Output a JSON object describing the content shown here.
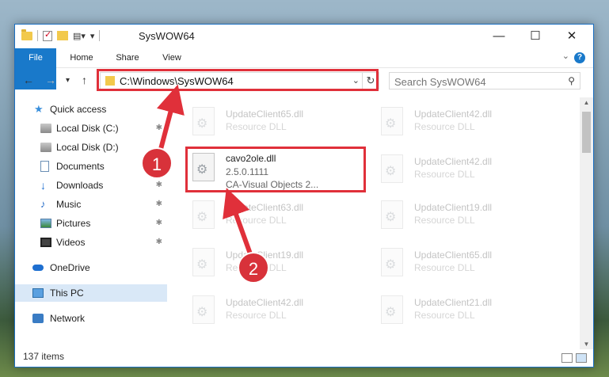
{
  "window": {
    "title": "SysWOW64"
  },
  "ribbon": {
    "tabs": [
      "File",
      "Home",
      "Share",
      "View"
    ]
  },
  "navbar": {
    "address": "C:\\Windows\\SysWOW64",
    "search_placeholder": "Search SysWOW64"
  },
  "sidebar": {
    "items": [
      {
        "label": "Quick access",
        "icon": "star-icon",
        "pinned": false
      },
      {
        "label": "Local Disk (C:)",
        "icon": "disk-icon",
        "pinned": true
      },
      {
        "label": "Local Disk (D:)",
        "icon": "disk-icon",
        "pinned": false
      },
      {
        "label": "Documents",
        "icon": "documents-icon",
        "pinned": true
      },
      {
        "label": "Downloads",
        "icon": "download-icon",
        "pinned": true
      },
      {
        "label": "Music",
        "icon": "music-icon",
        "pinned": true
      },
      {
        "label": "Pictures",
        "icon": "pictures-icon",
        "pinned": true
      },
      {
        "label": "Videos",
        "icon": "videos-icon",
        "pinned": true
      },
      {
        "label": "OneDrive",
        "icon": "onedrive-icon",
        "pinned": false
      },
      {
        "label": "This PC",
        "icon": "this-pc-icon",
        "pinned": false,
        "selected": true
      },
      {
        "label": "Network",
        "icon": "network-icon",
        "pinned": false
      }
    ]
  },
  "files": {
    "left": [
      {
        "name": "UpdateClient65.dll",
        "type": "Resource DLL"
      },
      {
        "name": "cavo2ole.dll",
        "version": "2.5.0.1111",
        "description": "CA-Visual Objects 2..."
      },
      {
        "name": "UpdateClient63.dll",
        "type": "Resource DLL"
      },
      {
        "name": "UpdateClient19.dll",
        "type": "Resource DLL"
      },
      {
        "name": "UpdateClient42.dll",
        "type": "Resource DLL"
      }
    ],
    "right": [
      {
        "name": "UpdateClient42.dll",
        "type": "Resource DLL"
      },
      {
        "name": "UpdateClient42.dll",
        "type": "Resource DLL"
      },
      {
        "name": "UpdateClient19.dll",
        "type": "Resource DLL"
      },
      {
        "name": "UpdateClient65.dll",
        "type": "Resource DLL"
      },
      {
        "name": "UpdateClient21.dll",
        "type": "Resource DLL"
      }
    ]
  },
  "status": {
    "item_count": "137 items"
  },
  "annotations": {
    "step1": "1",
    "step2": "2"
  },
  "colors": {
    "accent": "#1979ca",
    "annotation": "#e0303a"
  }
}
